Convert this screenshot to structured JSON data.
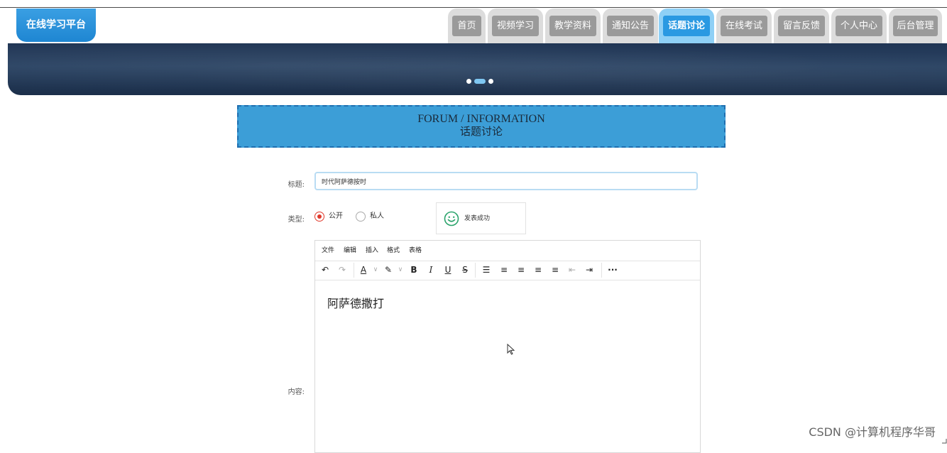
{
  "header": {
    "logo": "在线学习平台",
    "nav": [
      {
        "label": "首页",
        "active": false
      },
      {
        "label": "视频学习",
        "active": false
      },
      {
        "label": "教学资料",
        "active": false
      },
      {
        "label": "通知公告",
        "active": false
      },
      {
        "label": "话题讨论",
        "active": true
      },
      {
        "label": "在线考试",
        "active": false
      },
      {
        "label": "留言反馈",
        "active": false
      },
      {
        "label": "个人中心",
        "active": false
      },
      {
        "label": "后台管理",
        "active": false
      }
    ]
  },
  "banner": {
    "slides": 3,
    "active_slide": 2
  },
  "section": {
    "title_en": "FORUM / INFORMATION",
    "title_cn": "话题讨论"
  },
  "form": {
    "title_label": "标题:",
    "title_value": "时代阿萨德按时",
    "type_label": "类型:",
    "type_options": [
      {
        "label": "公开",
        "checked": true
      },
      {
        "label": "私人",
        "checked": false
      }
    ],
    "content_label": "内容:"
  },
  "toast": {
    "message": "发表成功",
    "icon": "smile-icon"
  },
  "editor": {
    "menu": [
      "文件",
      "编辑",
      "插入",
      "格式",
      "表格"
    ],
    "toolbar": {
      "undo": "↶",
      "redo": "↷",
      "text_color": "A",
      "highlight": "✎",
      "bold": "B",
      "italic": "I",
      "underline": "U",
      "strike": "S",
      "bullet_list": "☰",
      "align_left": "≡",
      "align_center": "≡",
      "align_right": "≡",
      "justify": "≡",
      "outdent": "⇤",
      "indent": "⇥",
      "more": "···",
      "dropdown": "∨"
    },
    "content": "阿萨德撒打"
  },
  "watermark": "CSDN @计算机程序华哥",
  "colors": {
    "accent": "#2a99e2",
    "banner": "#203554",
    "section_bg": "#3c9ed7",
    "radio_checked": "#e0392b",
    "toast_icon": "#2aa36b"
  }
}
